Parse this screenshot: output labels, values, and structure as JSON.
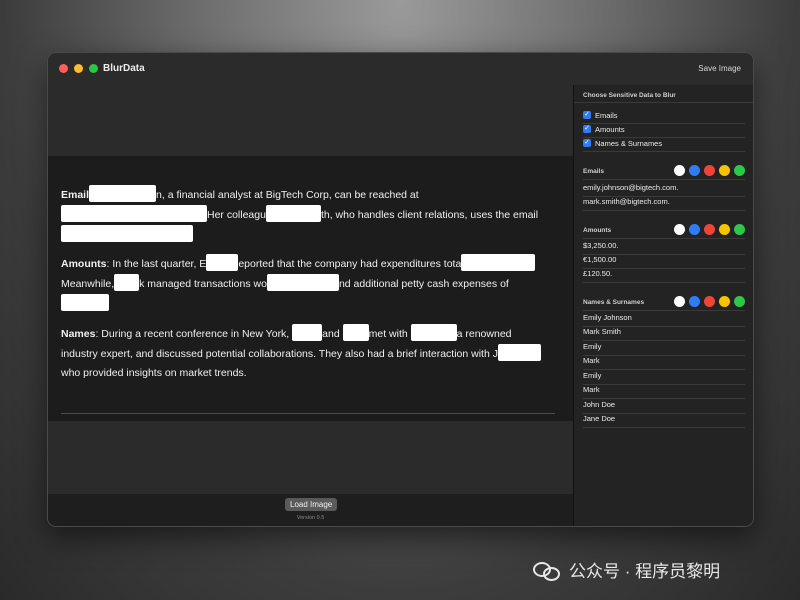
{
  "app": {
    "title": "BlurData",
    "save_label": "Save Image"
  },
  "content": {
    "email": {
      "label": "Email",
      "t1": ", a financial analyst at BigTech Corp, can be reached at",
      "t1_prefix": "",
      "t2": "Her colleagu",
      "t3": "th, who handles client relations, uses the email",
      "mid": "n"
    },
    "amounts": {
      "label": "Amounts",
      "t1": ": In the last quarter, E",
      "t2": "eported that the company had expenditures tota",
      "t3": "Meanwhile,",
      "t4": "k managed transactions wo",
      "t5": "nd additional petty cash expenses of"
    },
    "names": {
      "label": "Names",
      "t1": ": During a recent conference in New York,",
      "t2": "and",
      "t3": "met with",
      "t4": "a renowned",
      "t5": "industry expert, and discussed potential collaborations. They also had a brief interaction with J",
      "t6": "who provided insights on market trends."
    }
  },
  "load_label": "Load Image",
  "version": "Version 0.5",
  "sidebar": {
    "heading": "Choose Sensitive Data to Blur",
    "checks": [
      {
        "label": "Emails"
      },
      {
        "label": "Amounts"
      },
      {
        "label": "Names & Surnames"
      }
    ],
    "emails": {
      "label": "Emails",
      "items": [
        "emily.johnson@bigtech.com.",
        "mark.smith@bigtech.com."
      ]
    },
    "amounts": {
      "label": "Amounts",
      "items": [
        "$3,250.00.",
        "€1,500.00",
        "£120.50."
      ]
    },
    "names": {
      "label": "Names & Surnames",
      "items": [
        "Emily Johnson",
        "Mark Smith",
        "Emily",
        "Mark",
        "Emily",
        "Mark",
        "John Doe",
        "Jane Doe"
      ]
    },
    "swatch_colors": [
      "#ffffff",
      "#2f7df6",
      "#f04438",
      "#f7c500",
      "#2cc84a"
    ]
  },
  "watermark": {
    "text": "公众号 · 程序员黎明"
  }
}
